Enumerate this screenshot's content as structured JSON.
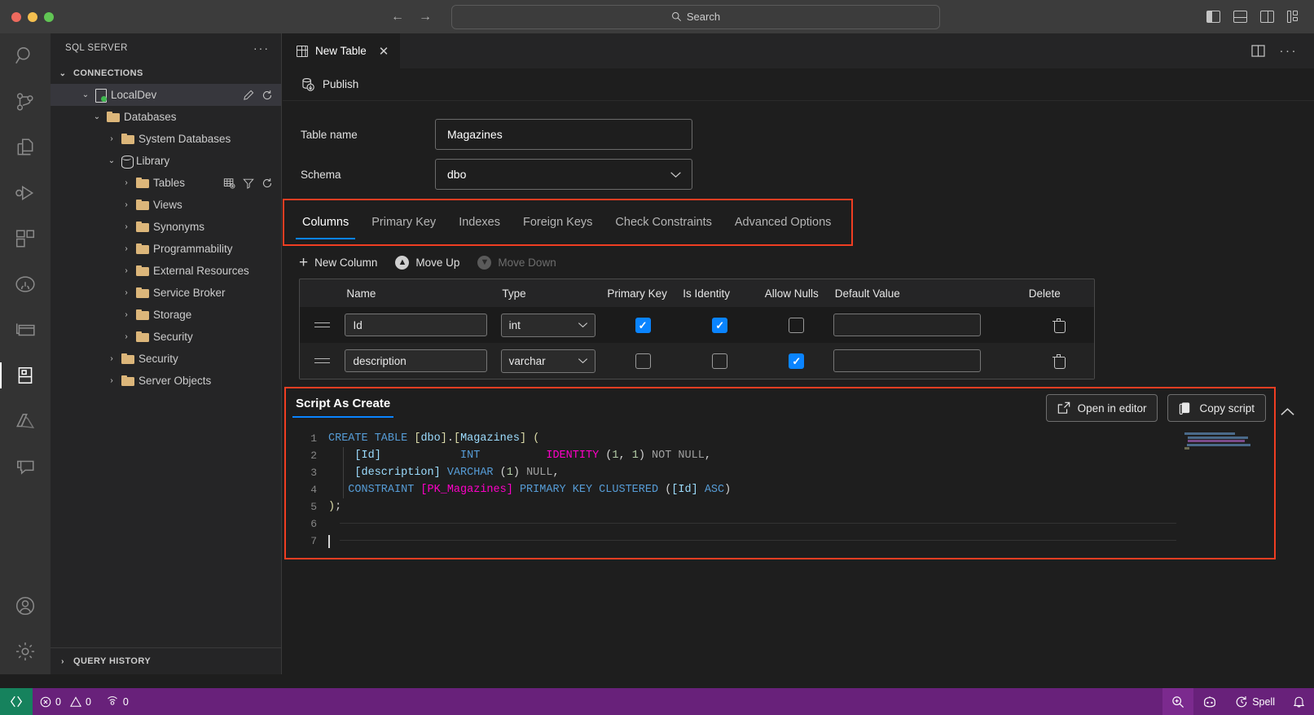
{
  "titlebar": {
    "search_placeholder": "Search",
    "search_icon": "search-icon",
    "back_arrow": "←",
    "forward_arrow": "→",
    "layout_icons": [
      "toggle-primary-sidebar-icon",
      "toggle-panel-icon",
      "toggle-secondary-sidebar-icon",
      "customize-layout-icon"
    ]
  },
  "activitybar": {
    "items": [
      {
        "name": "search-icon",
        "label": "Search"
      },
      {
        "name": "source-control-icon",
        "label": "Source Control"
      },
      {
        "name": "explorer-icon",
        "label": "Explorer"
      },
      {
        "name": "run-and-debug-icon",
        "label": "Run and Debug"
      },
      {
        "name": "extensions-icon",
        "label": "Extensions"
      },
      {
        "name": "github-icon",
        "label": "GitHub"
      },
      {
        "name": "notebooks-icon",
        "label": "Notebooks"
      },
      {
        "name": "sql-server-icon",
        "label": "SQL Server",
        "active": true
      },
      {
        "name": "azure-icon",
        "label": "Azure"
      },
      {
        "name": "chat-icon",
        "label": "Chat"
      }
    ],
    "bottom_items": [
      {
        "name": "accounts-icon",
        "label": "Accounts"
      },
      {
        "name": "settings-gear-icon",
        "label": "Manage"
      }
    ]
  },
  "sidebar": {
    "title": "SQL SERVER",
    "more_actions": "···",
    "section_label": "CONNECTIONS",
    "query_history_label": "QUERY HISTORY",
    "tree": [
      {
        "label": "LocalDev",
        "icon": "server-icon",
        "depth": 1,
        "expanded": true,
        "selected": true,
        "actions": [
          "edit-pencil-icon",
          "refresh-icon"
        ]
      },
      {
        "label": "Databases",
        "icon": "folder-icon",
        "depth": 2,
        "expanded": true
      },
      {
        "label": "System Databases",
        "icon": "folder-icon",
        "depth": 3,
        "expanded": false
      },
      {
        "label": "Library",
        "icon": "database-icon",
        "depth": 3,
        "expanded": true
      },
      {
        "label": "Tables",
        "icon": "folder-icon",
        "depth": 4,
        "expanded": false,
        "actions": [
          "new-table-icon",
          "filter-icon",
          "refresh-icon"
        ]
      },
      {
        "label": "Views",
        "icon": "folder-icon",
        "depth": 4,
        "expanded": false
      },
      {
        "label": "Synonyms",
        "icon": "folder-icon",
        "depth": 4,
        "expanded": false
      },
      {
        "label": "Programmability",
        "icon": "folder-icon",
        "depth": 4,
        "expanded": false
      },
      {
        "label": "External Resources",
        "icon": "folder-icon",
        "depth": 4,
        "expanded": false
      },
      {
        "label": "Service Broker",
        "icon": "folder-icon",
        "depth": 4,
        "expanded": false
      },
      {
        "label": "Storage",
        "icon": "folder-icon",
        "depth": 4,
        "expanded": false
      },
      {
        "label": "Security",
        "icon": "folder-icon",
        "depth": 4,
        "expanded": false
      },
      {
        "label": "Security",
        "icon": "folder-icon",
        "depth": 2,
        "expanded": false
      },
      {
        "label": "Server Objects",
        "icon": "folder-icon",
        "depth": 2,
        "expanded": false
      }
    ]
  },
  "editor": {
    "tab": {
      "label": "New Table",
      "icon": "table-icon",
      "close": "✕"
    },
    "tab_actions": [
      "split-editor-icon",
      "more-actions-icon"
    ],
    "toolbar": {
      "publish_label": "Publish",
      "publish_icon": "publish-database-icon"
    },
    "form": {
      "table_name_label": "Table name",
      "table_name_value": "Magazines",
      "schema_label": "Schema",
      "schema_value": "dbo",
      "schema_options": [
        "dbo"
      ]
    },
    "tabs": [
      {
        "label": "Columns",
        "active": true
      },
      {
        "label": "Primary Key",
        "active": false
      },
      {
        "label": "Indexes",
        "active": false
      },
      {
        "label": "Foreign Keys",
        "active": false
      },
      {
        "label": "Check Constraints",
        "active": false
      },
      {
        "label": "Advanced Options",
        "active": false
      }
    ],
    "grid_toolbar": [
      {
        "label": "New Column",
        "icon": "plus-icon",
        "disabled": false
      },
      {
        "label": "Move Up",
        "icon": "arrow-up-icon",
        "disabled": false
      },
      {
        "label": "Move Down",
        "icon": "arrow-down-icon",
        "disabled": true
      }
    ],
    "columns_grid": {
      "headers": [
        "Name",
        "Type",
        "Primary Key",
        "Is Identity",
        "Allow Nulls",
        "Default Value",
        "Delete"
      ],
      "rows": [
        {
          "name": "Id",
          "type": "varchar_or_int",
          "type_value": "int",
          "primary_key": true,
          "is_identity": true,
          "allow_nulls": false,
          "default_value": "",
          "delete_icon": "trash-icon"
        },
        {
          "name": "description",
          "type_value": "varchar",
          "primary_key": false,
          "is_identity": false,
          "allow_nulls": true,
          "default_value": "",
          "delete_icon": "trash-icon"
        }
      ]
    },
    "script_panel": {
      "title": "Script As Create",
      "open_in_editor_label": "Open in editor",
      "open_in_editor_icon": "external-link-icon",
      "copy_script_label": "Copy script",
      "copy_script_icon": "copy-icon",
      "collapse_icon": "chevron-up-icon",
      "line_numbers": [
        "1",
        "2",
        "3",
        "4",
        "5",
        "6",
        "7"
      ],
      "code_lines": [
        "CREATE TABLE [dbo].[Magazines] (",
        "    [Id]            INT          IDENTITY (1, 1) NOT NULL,",
        "    [description] VARCHAR (1) NULL,",
        "   CONSTRAINT [PK_Magazines] PRIMARY KEY CLUSTERED ([Id] ASC)",
        ");",
        "",
        ""
      ]
    }
  },
  "statusbar": {
    "remote_icon": "remote-connection-icon",
    "errors_icon": "error-icon",
    "errors_count": "0",
    "warnings_icon": "warning-icon",
    "warnings_count": "0",
    "ports_icon": "ports-icon",
    "ports_count": "0",
    "right_items": [
      {
        "name": "zoom-icon",
        "label": ""
      },
      {
        "name": "copilot-icon",
        "label": ""
      },
      {
        "name": "spell-icon",
        "label": "Spell"
      },
      {
        "name": "bell-icon",
        "label": ""
      }
    ]
  },
  "colors": {
    "accent_blue": "#0a84ff",
    "highlight_red": "#f03e22",
    "statusbar_purple": "#68217a",
    "remote_green": "#16825d",
    "folder_tan": "#dcb67a"
  }
}
